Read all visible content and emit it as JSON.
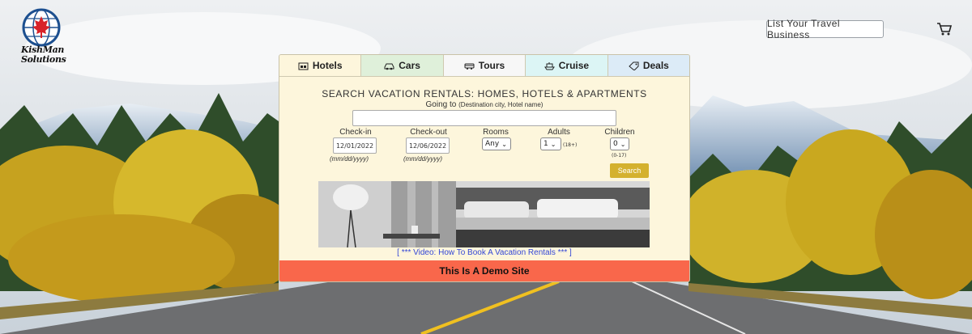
{
  "brand": {
    "line1": "KishMan",
    "line2": "Solutions"
  },
  "header": {
    "list_business_label": "List Your Travel Business"
  },
  "tabs": [
    {
      "label": "Hotels",
      "icon": "hotel-icon",
      "color": "#fdf6dc"
    },
    {
      "label": "Cars",
      "icon": "car-icon",
      "color": "#dff0da"
    },
    {
      "label": "Tours",
      "icon": "bus-icon",
      "color": "#f7f7f7"
    },
    {
      "label": "Cruise",
      "icon": "ship-icon",
      "color": "#dcf5f5"
    },
    {
      "label": "Deals",
      "icon": "tag-icon",
      "color": "#dcebf7"
    }
  ],
  "search": {
    "title": "SEARCH VACATION RENTALS: HOMES, HOTELS & APARTMENTS",
    "going_to_label": "Going to",
    "going_to_hint": "(Destination city, Hotel name)",
    "destination_value": "",
    "checkin_label": "Check-in",
    "checkin_value": "12/01/2022",
    "checkout_label": "Check-out",
    "checkout_value": "12/06/2022",
    "date_format_hint": "(mm/dd/yyyy)",
    "rooms_label": "Rooms",
    "rooms_value": "Any",
    "adults_label": "Adults",
    "adults_value": "1",
    "adults_hint": "(18+)",
    "children_label": "Children",
    "children_value": "0",
    "children_hint": "(0-17)",
    "search_button": "Search"
  },
  "video_link": "[ *** Video: How To Book A Vacation Rentals *** ]",
  "demo_banner": "This Is A Demo Site",
  "colors": {
    "demo_banner": "#f9674b",
    "search_button": "#d4b12e",
    "video_link": "#3346d6",
    "panel": "#fdf6dc"
  }
}
